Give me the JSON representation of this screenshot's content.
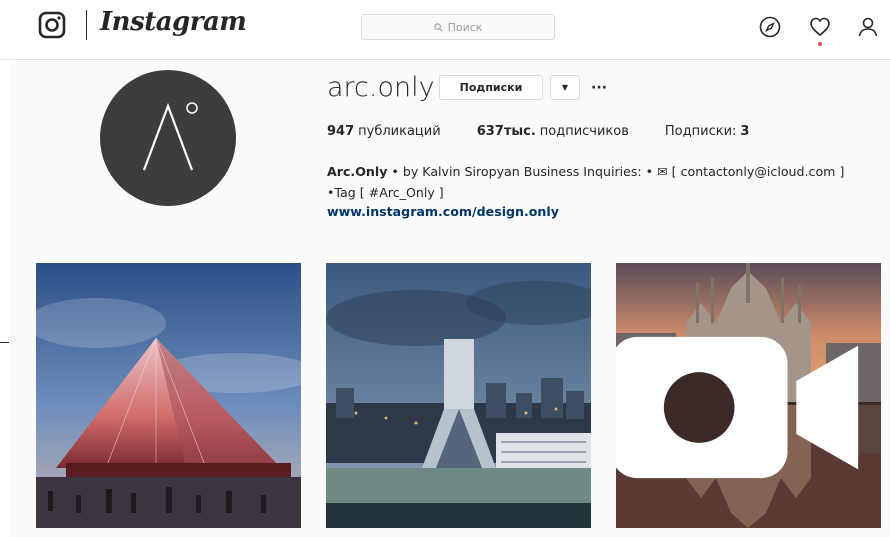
{
  "header": {
    "wordmark": "Instagram",
    "search_placeholder": "Поиск",
    "icons": [
      "instagram-logo-icon",
      "search-icon",
      "compass-icon",
      "heart-icon",
      "user-icon"
    ],
    "notification_color": "#ed4956"
  },
  "profile": {
    "username": "arc.only",
    "follow_button_label": "Подписки",
    "dropdown_glyph": "▼",
    "more_glyph": "···",
    "stats": {
      "posts_count": "947",
      "posts_label": "публикаций",
      "followers_count": "637тыс.",
      "followers_label": "подписчиков",
      "following_label": "Подписки:",
      "following_count": "3"
    },
    "bio": {
      "name": "Arc.Only",
      "text": " • by Kalvin Siropyan Business Inquiries: • ✉ [ contactonly@icloud.com ] •Tag [ #Arc_Only ]"
    },
    "link": "www.instagram.com/design.only",
    "avatar_color": "#3d3d3d"
  },
  "posts": [
    {
      "subject": "pyramid stadium at dusk",
      "type": "photo"
    },
    {
      "subject": "tower over waterfront at dusk",
      "type": "photo"
    },
    {
      "subject": "cathedral reflected at sunset",
      "type": "video"
    }
  ],
  "colors": {
    "link": "#003569",
    "border": "#dbdbdb",
    "background": "#fafafa"
  }
}
